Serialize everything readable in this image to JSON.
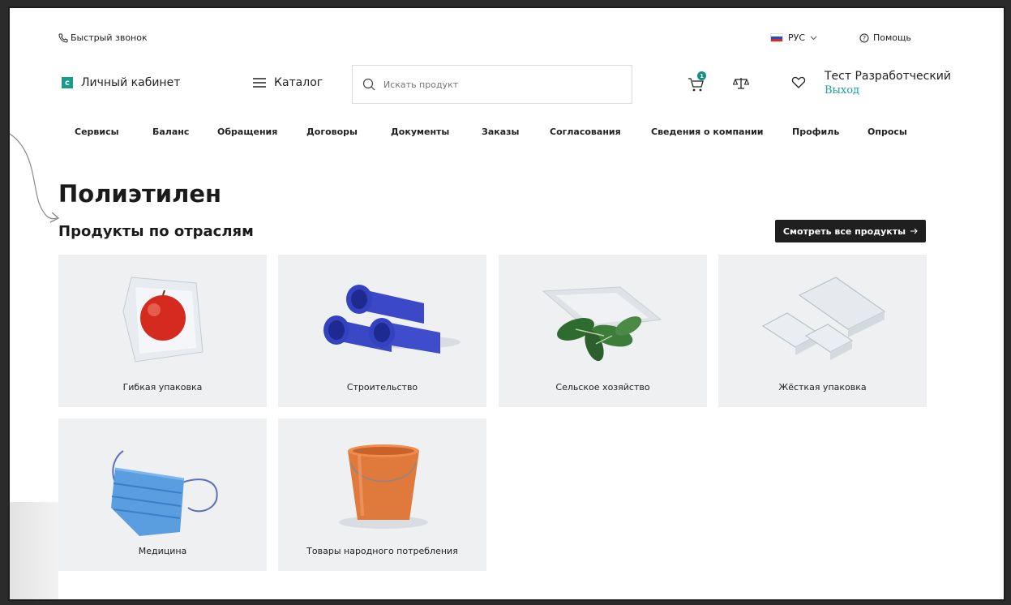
{
  "topbar": {
    "quick_call": "Быстрый звонок",
    "language": "РУС",
    "help": "Помощь"
  },
  "header": {
    "account_label": "Личный кабинет",
    "catalog_label": "Каталог",
    "search_placeholder": "Искать продукт",
    "cart_count": "1",
    "user_name": "Тест Разработческий",
    "logout_label": "Выход"
  },
  "nav": {
    "items": [
      "Сервисы",
      "Баланс",
      "Обращения",
      "Договоры",
      "Документы",
      "Заказы",
      "Согласования",
      "Сведения о компании",
      "Профиль",
      "Опросы"
    ]
  },
  "page": {
    "title": "Полиэтилен",
    "section_title": "Продукты по отраслям",
    "view_all_label": "Смотреть все продукты"
  },
  "industries": [
    {
      "label": "Гибкая упаковка",
      "icon": "apple-in-bag"
    },
    {
      "label": "Строительство",
      "icon": "blue-pipes"
    },
    {
      "label": "Сельское хозяйство",
      "icon": "plant-film"
    },
    {
      "label": "Жёсткая упаковка",
      "icon": "plastic-containers"
    },
    {
      "label": "Медицина",
      "icon": "medical-mask"
    },
    {
      "label": "Товары народного потребления",
      "icon": "orange-bucket"
    }
  ],
  "colors": {
    "accent": "#179c8a",
    "dark_button": "#1f1f1f",
    "card_bg": "#eef0f2"
  }
}
